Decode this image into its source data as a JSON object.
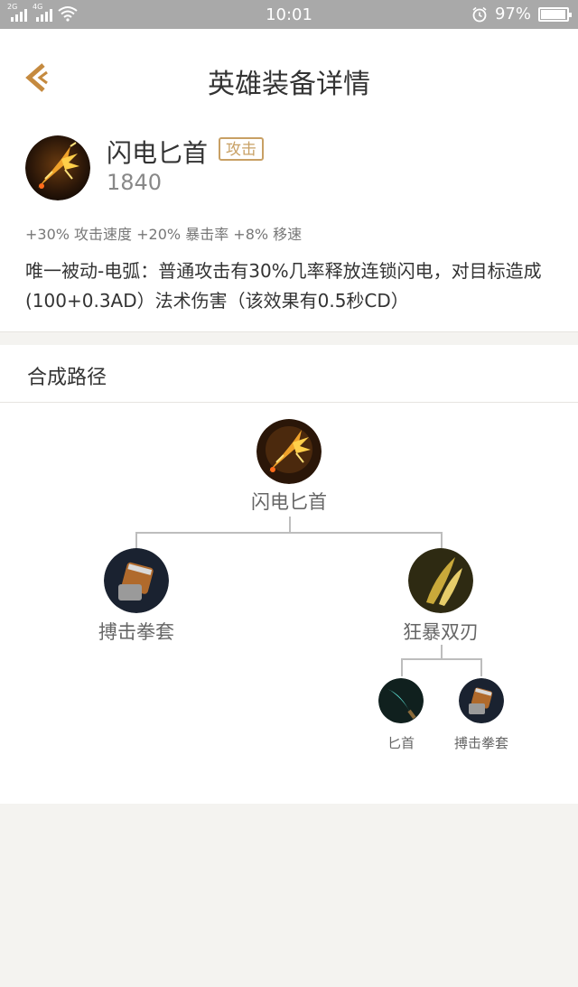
{
  "status_bar": {
    "network_1": "2G",
    "network_2": "4G",
    "time": "10:01",
    "battery": "97%",
    "battery_level": 0.97
  },
  "header": {
    "title": "英雄装备详情",
    "back_icon": "chevron-left-icon"
  },
  "item": {
    "name": "闪电匕首",
    "type_badge": "攻击",
    "price": "1840",
    "stats": "+30% 攻击速度 +20% 暴击率 +8% 移速",
    "description": "唯一被动-电弧：普通攻击有30%几率释放连锁闪电，对目标造成(100+0.3AD）法术伤害（该效果有0.5秒CD）"
  },
  "recipe": {
    "title": "合成路径",
    "root": {
      "name": "闪电匕首"
    },
    "children": [
      {
        "name": "搏击拳套"
      },
      {
        "name": "狂暴双刃",
        "children": [
          {
            "name": "匕首"
          },
          {
            "name": "搏击拳套"
          }
        ]
      }
    ]
  },
  "colors": {
    "accent": "#c8a064",
    "back_arrow": "#c58a3f",
    "page_bg": "#f4f3f0",
    "status_bar_bg": "#a9a9a9"
  }
}
